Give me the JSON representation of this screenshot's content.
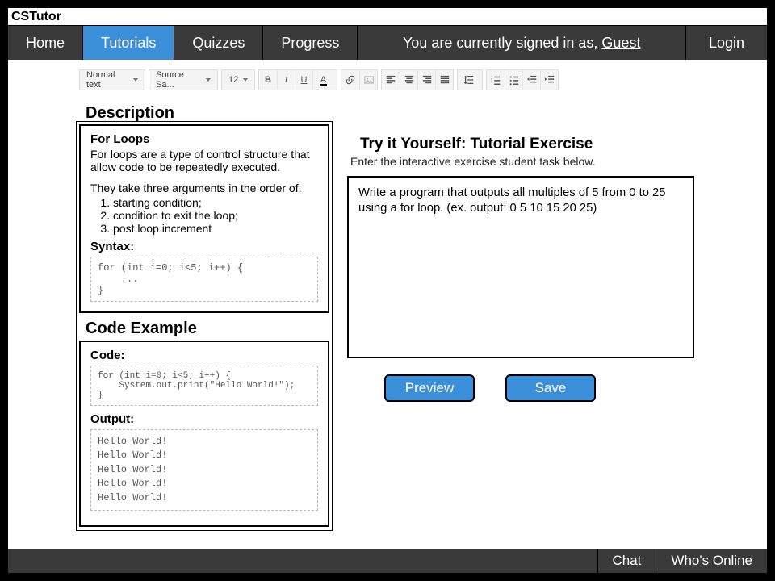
{
  "app": {
    "title": "CSTutor"
  },
  "nav": {
    "home": "Home",
    "tutorials": "Tutorials",
    "quizzes": "Quizzes",
    "progress": "Progress",
    "signed_in_prefix": "You are currently signed in as, ",
    "signed_in_user": "Guest",
    "login": "Login"
  },
  "toolbar": {
    "style_dd": "Normal text",
    "font_dd": "Source Sa...",
    "size_dd": "12"
  },
  "left": {
    "description_heading": "Description",
    "desc_title": "For Loops",
    "desc_p1": "For loops are a type of control structure that allow code to be repeatedly executed.",
    "desc_p2": "They take three arguments in the order of:",
    "desc_li1": "starting condition;",
    "desc_li2": "condition to exit the loop;",
    "desc_li3": "post loop increment",
    "syntax_label": "Syntax:",
    "syntax_code": "for (int i=0; i<5; i++) {\n    ...\n}",
    "code_example_heading": "Code Example",
    "code_label": "Code:",
    "code_code": "for (int i=0; i<5; i++) {\n    System.out.print(\"Hello World!\");\n}",
    "output_label": "Output:",
    "output_text": "Hello World!\nHello World!\nHello World!\nHello World!\nHello World!"
  },
  "right": {
    "try_title": "Try it Yourself: Tutorial Exercise",
    "try_sub": "Enter the interactive exercise student task below.",
    "exercise_text": "Write a program that outputs all multiples of 5 from 0 to 25 using a for loop. (ex. output: 0  5  10  15  20  25)",
    "preview": "Preview",
    "save": "Save"
  },
  "footer": {
    "chat": "Chat",
    "whos_online": "Who's Online"
  }
}
